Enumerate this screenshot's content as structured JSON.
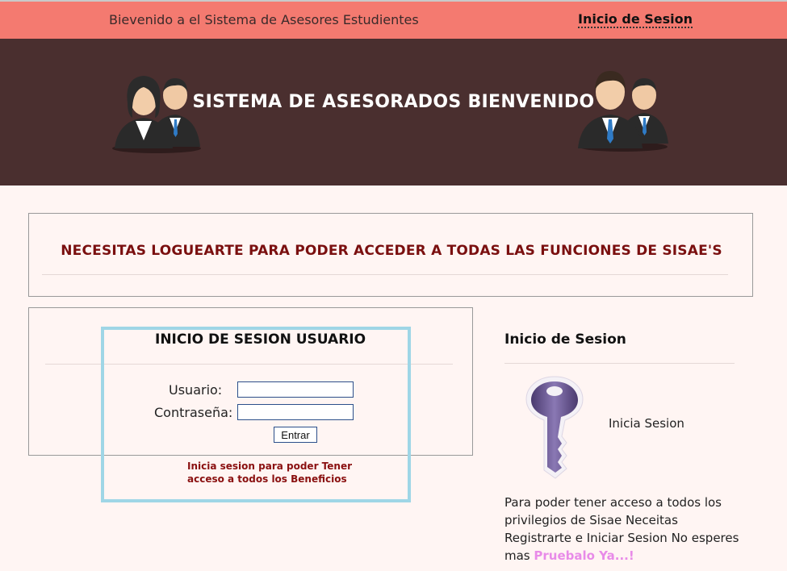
{
  "topbar": {
    "welcome": "Bievenido a el Sistema de Asesores Estudientes",
    "login_link": "Inicio de Sesion"
  },
  "hero": {
    "title": "SISTEMA DE ASESORADOS BIENVENIDO",
    "left_icon": "people-icon",
    "right_icon": "people-icon"
  },
  "notice": {
    "message": "NECESITAS LOGUEARTE PARA PODER ACCEDER A TODAS LAS FUNCIONES DE SISAE'S"
  },
  "login": {
    "title": "INICIO DE SESION USUARIO",
    "user_label": "Usuario:",
    "password_label": "Contraseña:",
    "user_value": "",
    "password_value": "",
    "submit_label": "Entrar",
    "hint_line1": "Inicia sesion para poder Tener",
    "hint_line2": "acceso a todos los Beneficios"
  },
  "side": {
    "title": "Inicio de Sesion",
    "key_icon": "key-icon",
    "key_label": "Inicia Sesion",
    "description_line1": "Para poder tener acceso a todos los",
    "description_line2": "privilegios de Sisae Neceitas",
    "description_line3": "Registrarte e Iniciar Sesion No esperes",
    "description_line4_prefix": "mas",
    "description_cta": "Pruebalo Ya...!"
  },
  "colors": {
    "topbar": "#f47a70",
    "hero": "#4a2f2f",
    "accent_text": "#7a0f0f",
    "highlight_border": "#9fd6e6",
    "cta": "#e88be8"
  }
}
